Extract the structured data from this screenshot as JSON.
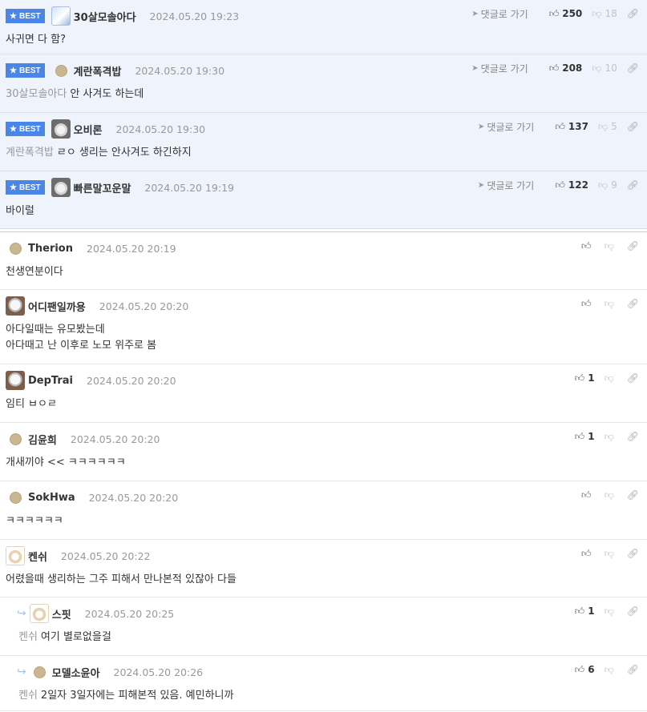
{
  "best_label": "BEST",
  "goto_label": "댓글로 가기",
  "comments": [
    {
      "best": true,
      "avatar": "blue",
      "nick": "30살모솔아다",
      "date": "2024.05.20 19:23",
      "up": "250",
      "down": "18",
      "mention": "",
      "lines": [
        "사귀면 다 함?"
      ]
    },
    {
      "best": true,
      "avatar": "dot",
      "nick": "계란폭격밥",
      "date": "2024.05.20 19:30",
      "up": "208",
      "down": "10",
      "mention": "30살모솔아다",
      "lines": [
        "안 사겨도 하는데"
      ]
    },
    {
      "best": true,
      "avatar": "bear",
      "nick": "오비론",
      "date": "2024.05.20 19:30",
      "up": "137",
      "down": "5",
      "mention": "계란폭격밥",
      "lines": [
        "ㄹㅇ 생리는 안사겨도 하긴하지"
      ]
    },
    {
      "best": true,
      "avatar": "bear",
      "nick": "빠른말꼬운말",
      "date": "2024.05.20 19:19",
      "up": "122",
      "down": "9",
      "mention": "",
      "lines": [
        "바이럴"
      ]
    },
    {
      "best": false,
      "avatar": "dot",
      "nick": "Therion",
      "date": "2024.05.20 20:19",
      "up": "",
      "down": "",
      "mention": "",
      "lines": [
        "천생연분이다"
      ]
    },
    {
      "best": false,
      "avatar": "dog",
      "nick": "어디팬일까용",
      "date": "2024.05.20 20:20",
      "up": "",
      "down": "",
      "mention": "",
      "lines": [
        "아다일때는 유모봤는데",
        "아다때고 난 이후로 노모 위주로 봄"
      ]
    },
    {
      "best": false,
      "avatar": "dog",
      "nick": "DepTrai",
      "date": "2024.05.20 20:20",
      "up": "1",
      "down": "",
      "mention": "",
      "lines": [
        "임티 ㅂㅇㄹ"
      ]
    },
    {
      "best": false,
      "avatar": "dot",
      "nick": "김윤희",
      "date": "2024.05.20 20:20",
      "up": "1",
      "down": "",
      "mention": "",
      "lines": [
        "개새끼야 << ㅋㅋㅋㅋㅋㅋ"
      ]
    },
    {
      "best": false,
      "avatar": "dot",
      "nick": "SokHwa",
      "date": "2024.05.20 20:20",
      "up": "",
      "down": "",
      "mention": "",
      "lines": [
        "ㅋㅋㅋㅋㅋㅋ"
      ]
    },
    {
      "best": false,
      "avatar": "pup",
      "nick": "켄쉬",
      "date": "2024.05.20 20:22",
      "up": "",
      "down": "",
      "mention": "",
      "lines": [
        "어렸을때 생리하는 그주 피해서 만나본적 있잖아 다들"
      ]
    },
    {
      "best": false,
      "reply": true,
      "avatar": "pup",
      "nick": "스핏",
      "date": "2024.05.20 20:25",
      "up": "1",
      "down": "",
      "mention": "켄쉬",
      "lines": [
        "여기 별로없을걸"
      ]
    },
    {
      "best": false,
      "reply": true,
      "avatar": "dot",
      "nick": "모델소윤아",
      "date": "2024.05.20 20:26",
      "up": "6",
      "down": "",
      "mention": "켄쉬",
      "lines": [
        "2일자 3일자에는 피해본적 있음. 예민하니까"
      ]
    }
  ],
  "icons": {
    "up": "thumbs-up-icon",
    "down": "thumbs-down-icon",
    "link": "link-icon",
    "goto": "send-arrow-icon",
    "star": "star-icon",
    "reply": "reply-arrow-icon"
  }
}
